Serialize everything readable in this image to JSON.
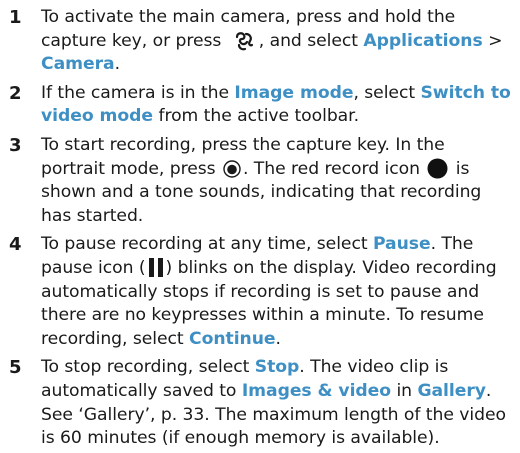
{
  "steps": [
    {
      "number": "1",
      "t1": "To activate the main camera, press and hold the capture key, or press",
      "t2": ", and select",
      "ui_applications": "Applications",
      "t3": " > ",
      "ui_camera": "Camera",
      "t4": "."
    },
    {
      "number": "2",
      "t1": "If the camera is in the ",
      "ui_image_mode": "Image mode",
      "t2": ", select ",
      "ui_switch": "Switch to video mode",
      "t3": " from the active toolbar."
    },
    {
      "number": "3",
      "t1": "To start recording, press the capture key. In the portrait mode, press",
      "t2": ". The red record icon",
      "t3": "is shown and a tone sounds, indicating that recording has started."
    },
    {
      "number": "4",
      "t1": "To pause recording at any time, select ",
      "ui_pause": "Pause",
      "t2": ". The pause icon (",
      "t3": ") blinks on the display. Video recording automatically stops if recording is set to pause and there are no keypresses within a minute. To resume recording, select ",
      "ui_continue": "Continue",
      "t4": "."
    },
    {
      "number": "5",
      "t1": "To stop recording, select ",
      "ui_stop": "Stop",
      "t2": ". The video clip is automatically saved to ",
      "ui_images_video": "Images & video",
      "t3": " in ",
      "ui_gallery": "Gallery",
      "t4": ". See ‘Gallery’, p. 33. The maximum length of the video is 60 minutes (if enough memory is available)."
    }
  ],
  "colors": {
    "ui_label": "#3d8fc4",
    "text": "#1a1a1a",
    "record_icon": "#111111"
  },
  "icons": {
    "menu_key": "menu-key-icon",
    "capture": "capture-button-icon",
    "record": "record-icon",
    "pause": "pause-icon"
  }
}
